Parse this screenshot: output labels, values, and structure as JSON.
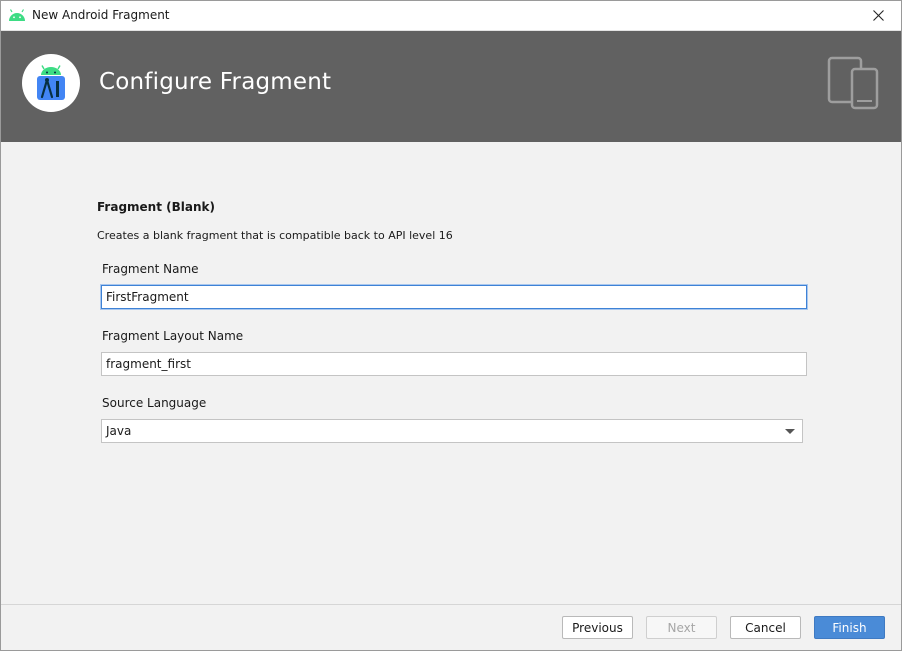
{
  "window": {
    "title": "New Android Fragment",
    "close_glyph": "✕"
  },
  "header": {
    "title": "Configure Fragment",
    "logo_icon": "android-studio-logo-icon",
    "device_icon": "tablet-phone-icon",
    "background_color": "#616161"
  },
  "template": {
    "name": "Fragment (Blank)",
    "description": "Creates a blank fragment that is compatible back to API level 16"
  },
  "fields": {
    "fragment_name": {
      "label": "Fragment Name",
      "value": "FirstFragment"
    },
    "layout_name": {
      "label": "Fragment Layout Name",
      "value": "fragment_first"
    },
    "source_language": {
      "label": "Source Language",
      "value": "Java"
    }
  },
  "footer": {
    "previous_label": "Previous",
    "next_label": "Next",
    "cancel_label": "Cancel",
    "finish_label": "Finish",
    "accent_color": "#4a8bd7"
  }
}
